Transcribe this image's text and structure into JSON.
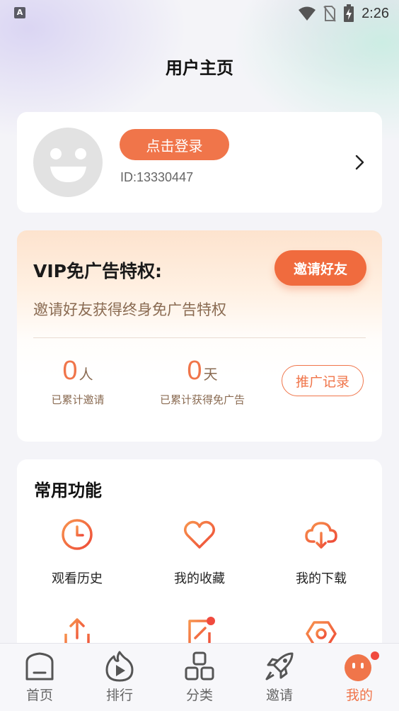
{
  "status_bar": {
    "app_indicator": "A",
    "time": "2:26"
  },
  "page": {
    "title": "用户主页"
  },
  "profile": {
    "login_label": "点击登录",
    "user_id": "ID:13330447"
  },
  "vip": {
    "title": "VIP免广告特权:",
    "invite_label": "邀请好友",
    "subtitle": "邀请好友获得终身免广告特权",
    "invited_count": "0",
    "invited_unit": "人",
    "invited_label": "已累计邀请",
    "days_count": "0",
    "days_unit": "天",
    "days_label": "已累计获得免广告",
    "record_label": "推广记录"
  },
  "functions": {
    "title": "常用功能",
    "items": [
      {
        "label": "观看历史",
        "icon": "clock-icon"
      },
      {
        "label": "我的收藏",
        "icon": "heart-icon"
      },
      {
        "label": "我的下载",
        "icon": "cloud-download-icon"
      },
      {
        "label": "",
        "icon": "upload-icon"
      },
      {
        "label": "",
        "icon": "edit-note-icon",
        "badge": true
      },
      {
        "label": "",
        "icon": "settings-icon"
      }
    ]
  },
  "tabbar": {
    "items": [
      {
        "label": "首页",
        "icon": "home-icon",
        "active": false
      },
      {
        "label": "排行",
        "icon": "flame-play-icon",
        "active": false
      },
      {
        "label": "分类",
        "icon": "category-icon",
        "active": false
      },
      {
        "label": "邀请",
        "icon": "rocket-icon",
        "active": false
      },
      {
        "label": "我的",
        "icon": "profile-face-icon",
        "active": true
      }
    ]
  },
  "colors": {
    "accent": "#f0754a",
    "accent_dark": "#f06b3e",
    "brown_text": "#8a6b52",
    "badge": "#f04a3e"
  }
}
